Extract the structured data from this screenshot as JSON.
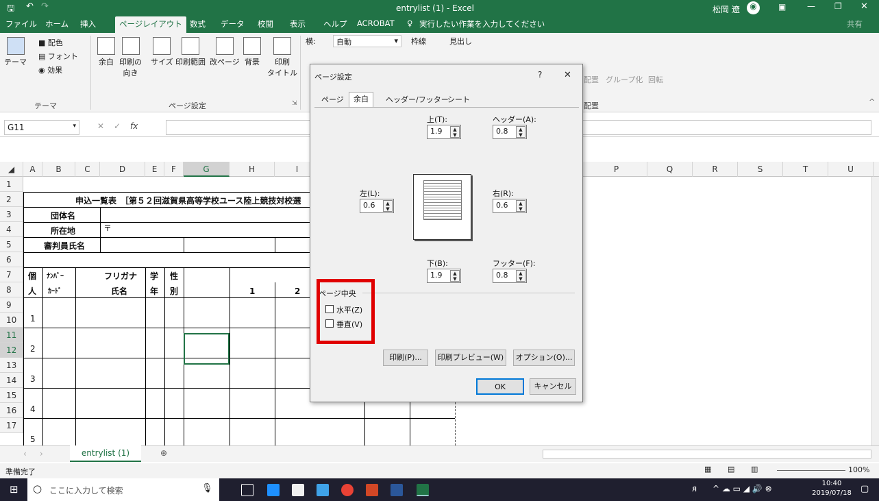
{
  "window": {
    "title": "entrylist (1) - Excel",
    "user": "松岡 遼"
  },
  "ribbon_tabs": [
    "ファイル",
    "ホーム",
    "挿入",
    "ページレイアウト",
    "数式",
    "データ",
    "校閲",
    "表示",
    "ヘルプ",
    "ACROBAT"
  ],
  "tell_me": "実行したい作業を入力してください",
  "share": "共有",
  "ribbon": {
    "theme_group": {
      "themes": "テーマ",
      "colors": "配色",
      "fonts": "フォント",
      "effects": "効果",
      "label": "テーマ"
    },
    "page_setup_group": {
      "margins": "余白",
      "orientation": "印刷の\n向き",
      "size": "サイズ",
      "print_area": "印刷範囲",
      "breaks": "改ページ",
      "background": "背景",
      "print_titles": "印刷\nタイトル",
      "label": "ページ設定"
    },
    "scale": {
      "width_label": "横:",
      "width_value": "自動"
    },
    "sheet_options": {
      "gridlines": "枠線",
      "headings": "見出し"
    },
    "arrange": {
      "align": "配置",
      "group": "グループ化",
      "rotate": "回転",
      "label": "配置"
    }
  },
  "formula_bar": {
    "name_box": "G11",
    "fx": "fx"
  },
  "columns": [
    "A",
    "B",
    "C",
    "D",
    "E",
    "F",
    "G",
    "H",
    "I",
    "P",
    "Q",
    "R",
    "S",
    "T",
    "U"
  ],
  "rows": [
    "1",
    "2",
    "3",
    "4",
    "5",
    "6",
    "7",
    "8",
    "9",
    "10",
    "11",
    "12",
    "13",
    "14",
    "15",
    "16",
    "17"
  ],
  "sheet": {
    "title": "申込一覧表　［第５２回滋賀県高等学校ユース陸上競技対校選",
    "team_label": "団体名",
    "address_label": "所在地",
    "postal": "〒",
    "judge_label": "審判員氏名",
    "h_ko": "個",
    "h_jin": "人",
    "h_number1": "ﾅﾝﾊﾞｰ",
    "h_number2": "ｶｰﾄﾞ",
    "h_furigana": "フリガナ",
    "h_name": "氏名",
    "h_grade1": "学",
    "h_grade2": "年",
    "h_sex1": "性",
    "h_sex2": "別",
    "h_col1": "1",
    "h_col2": "2",
    "entries": [
      "1",
      "2",
      "3",
      "4",
      "5"
    ]
  },
  "sheet_tab": "entrylist (1)",
  "status": {
    "ready": "準備完了",
    "zoom": "100%"
  },
  "taskbar": {
    "search_placeholder": "ここに入力して検索",
    "time": "10:40",
    "date": "2019/07/18"
  },
  "dialog": {
    "title": "ページ設定",
    "help": "?",
    "close": "✕",
    "tabs": [
      "ページ",
      "余白",
      "ヘッダー/フッター",
      "シート"
    ],
    "top_label": "上(T):",
    "top_value": "1.9",
    "header_label": "ヘッダー(A):",
    "header_value": "0.8",
    "left_label": "左(L):",
    "left_value": "0.6",
    "right_label": "右(R):",
    "right_value": "0.6",
    "bottom_label": "下(B):",
    "bottom_value": "1.9",
    "footer_label": "フッター(F):",
    "footer_value": "0.8",
    "center_group": "ページ中央",
    "horizontal": "水平(Z)",
    "vertical": "垂直(V)",
    "print_btn": "印刷(P)...",
    "preview_btn": "印刷プレビュー(W)",
    "options_btn": "オプション(O)...",
    "ok": "OK",
    "cancel": "キャンセル"
  },
  "colors": {
    "excel_green": "#217346",
    "highlight_red": "#e00000"
  }
}
